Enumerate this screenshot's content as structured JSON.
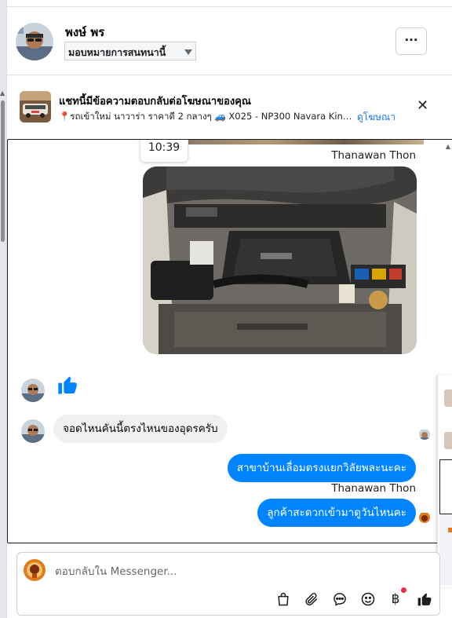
{
  "header": {
    "contact_name": "พงษ์ พร",
    "assign_label": "มอบหมายการสนทนานี้",
    "more_label": "···"
  },
  "ad_banner": {
    "title": "แชทนี้มีข้อความตอบกลับต่อโฆษณาของคุณ",
    "description": "📍รถเข้าใหม่ นาวาร่า ราคาดี 2 กลางๆ 🚙 X025 - NP300 Navara King C...",
    "view_link": "ดูโฆษณา",
    "close_label": "✕"
  },
  "thread": {
    "timestamp": "10:39",
    "messages": [
      {
        "from": "page",
        "sender": "Thanawan Thon",
        "kind": "image",
        "alt": "engine bay photo"
      },
      {
        "from": "customer",
        "kind": "thumbs-up"
      },
      {
        "from": "customer",
        "kind": "text",
        "text": "จอดไหนคันนี้ตรงไหนของอุดรครับ"
      },
      {
        "from": "page",
        "kind": "text",
        "text": "สาขาบ้านเลื่อมตรงแยกวิลัยพละนะคะ"
      },
      {
        "from": "page",
        "sender": "Thanawan Thon",
        "kind": "text",
        "text": "ลูกค้าสะดวกเข้ามาดูวันไหนคะ"
      }
    ]
  },
  "composer": {
    "placeholder": "ตอบกลับใน Messenger...",
    "tools": [
      "bag-icon",
      "paperclip-icon",
      "chat-bubble-icon",
      "emoji-icon",
      "baht-icon",
      "thumbs-up-icon"
    ],
    "baht_glyph": "฿"
  },
  "colors": {
    "accent": "#0084ff",
    "link": "#1877f2",
    "incoming_bubble": "#f0f0f0",
    "notification": "#f02849"
  }
}
